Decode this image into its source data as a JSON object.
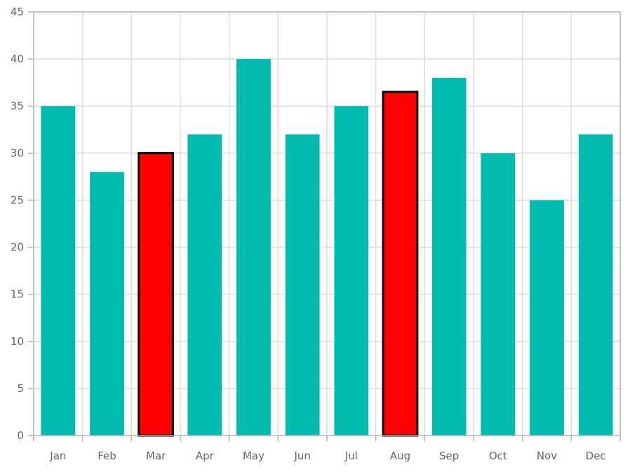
{
  "chart_data": {
    "type": "bar",
    "title": "",
    "xlabel": "",
    "ylabel": "",
    "categories": [
      "Jan",
      "Feb",
      "Mar",
      "Apr",
      "May",
      "Jun",
      "Jul",
      "Aug",
      "Sep",
      "Oct",
      "Nov",
      "Dec"
    ],
    "values": [
      35,
      28,
      30,
      32,
      40,
      32,
      35,
      36.5,
      38,
      30,
      25,
      32
    ],
    "highlighted": [
      "Mar",
      "Aug"
    ],
    "ylim": [
      0,
      45
    ],
    "yticks": [
      0,
      5,
      10,
      15,
      20,
      25,
      30,
      35,
      40,
      45
    ],
    "grid": true,
    "legend": "none",
    "colors": {
      "bar": "#00BCAE",
      "highlight": "#FF0000",
      "highlight_stroke": "#000000",
      "grid": "#DDDDDD",
      "axis": "#B3B3B3",
      "label": "#666666"
    }
  }
}
